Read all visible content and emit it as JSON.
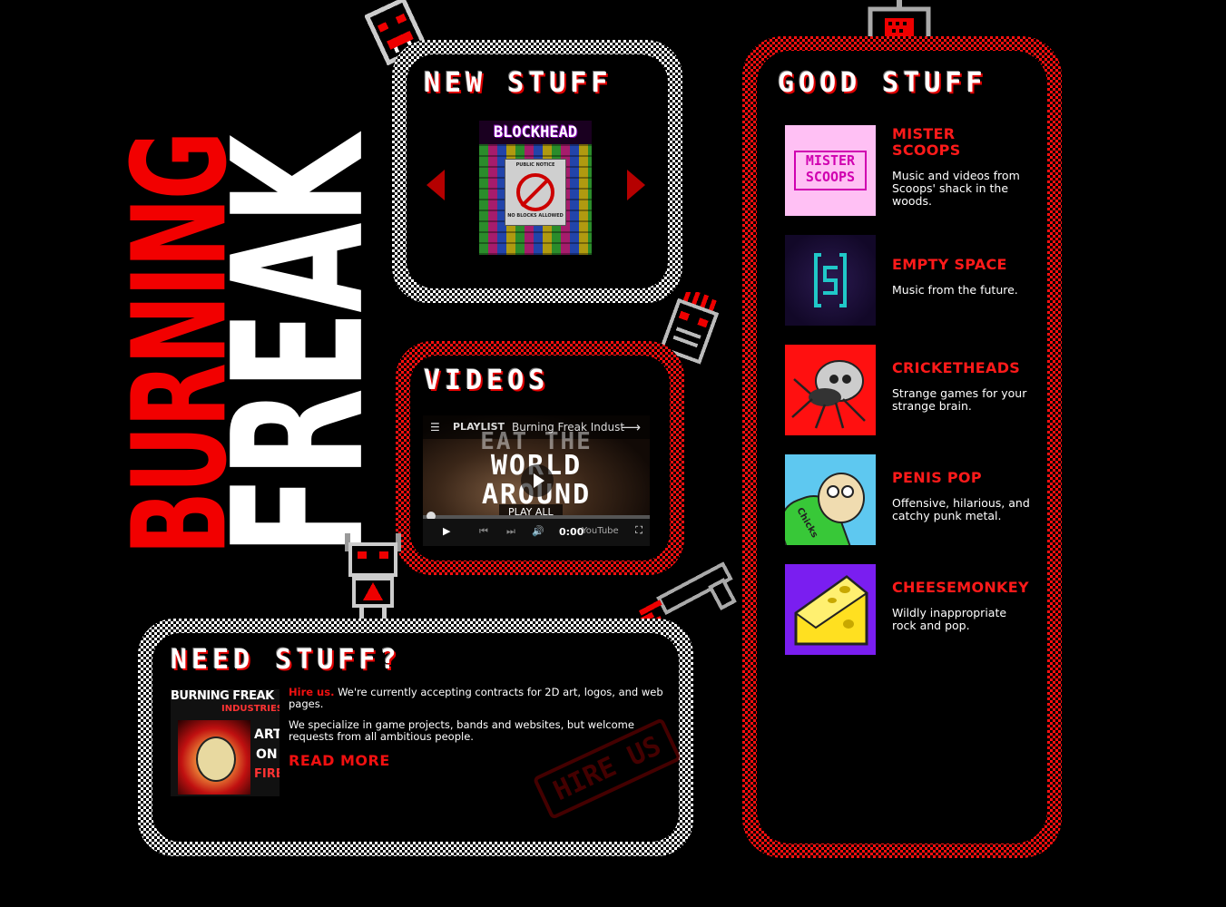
{
  "logo": {
    "word1": "BURNING",
    "word2": "FREAK"
  },
  "new_stuff": {
    "title": "NEW STUFF",
    "feature": {
      "title": "BLOCKHEAD",
      "notice_header": "PUBLIC NOTICE",
      "notice_footer": "NO BLOCKS ALLOWED"
    }
  },
  "videos": {
    "title": "VIDEOS",
    "playlist_label": "PLAYLIST",
    "channel_title": "Burning Freak Indust",
    "overlay_line1": "EAT THE",
    "overlay_line2": "WORLD",
    "overlay_line3": "AROUND",
    "play_all": "PLAY ALL",
    "time": "0:00",
    "youtube_label": "YouTube"
  },
  "need_stuff": {
    "title": "NEED STUFF?",
    "logo_line1": "BURNING FREAK",
    "logo_line2": "INDUSTRIES",
    "logo_side1": "ART",
    "logo_side2": "ON",
    "logo_side3": "FIRE",
    "hire_em": "Hire us.",
    "hire_text": " We're currently accepting contracts for 2D art, logos, and web pages.",
    "specialize_text": "We specialize in game projects, bands and websites, but welcome requests from all ambitious people.",
    "read_more": "READ MORE",
    "stamp": "HIRE US"
  },
  "good_stuff": {
    "title": "GOOD STUFF",
    "items": [
      {
        "title_line1": "MISTER",
        "title_line2": "SCOOPS",
        "desc": "Music and videos from Scoops' shack in the woods.",
        "thumb_text1": "MISTER",
        "thumb_text2": "SCOOPS"
      },
      {
        "title_line1": "EMPTY SPACE",
        "title_line2": "",
        "desc": "Music from the future.",
        "thumb_text1": "",
        "thumb_text2": ""
      },
      {
        "title_line1": "CRICKETHEADS",
        "title_line2": "",
        "desc": "Strange games for your strange brain.",
        "thumb_text1": "",
        "thumb_text2": ""
      },
      {
        "title_line1": "PENIS POP",
        "title_line2": "",
        "desc": "Offensive, hilarious, and catchy punk metal.",
        "thumb_text1": "Chicks",
        "thumb_text2": ""
      },
      {
        "title_line1": "CHEESEMONKEY",
        "title_line2": "",
        "desc": "Wildly inappropriate rock and pop.",
        "thumb_text1": "",
        "thumb_text2": ""
      }
    ]
  },
  "colors": {
    "accent": "#f20000",
    "background": "#000000",
    "text": "#ffffff"
  }
}
